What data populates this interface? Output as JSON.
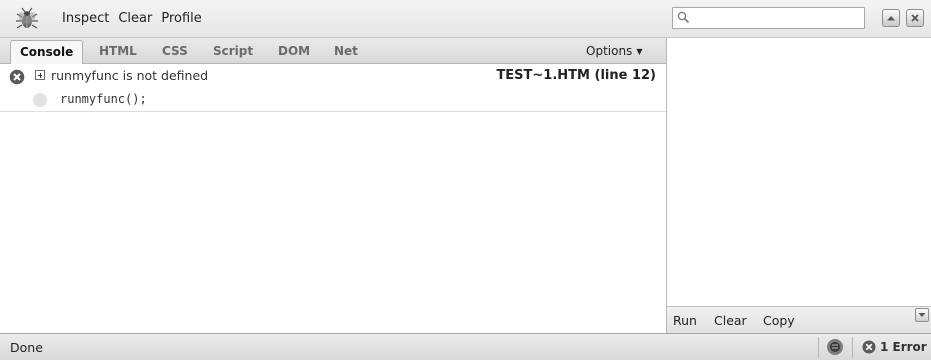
{
  "toolbar": {
    "menu": [
      "Inspect",
      "Clear",
      "Profile"
    ]
  },
  "search": {
    "value": "",
    "placeholder": ""
  },
  "tabs": [
    {
      "label": "Console",
      "active": true
    },
    {
      "label": "HTML",
      "active": false
    },
    {
      "label": "CSS",
      "active": false
    },
    {
      "label": "Script",
      "active": false
    },
    {
      "label": "DOM",
      "active": false
    },
    {
      "label": "Net",
      "active": false
    }
  ],
  "options_label": "Options",
  "console": {
    "error_message": "runmyfunc is not defined",
    "error_source": "TEST~1.HTM (line 12)",
    "source_line": "runmyfunc();"
  },
  "command_bar": {
    "run": "Run",
    "clear": "Clear",
    "copy": "Copy"
  },
  "status": {
    "text": "Done",
    "error_count": "1 Error"
  },
  "icons": {
    "app": "firebug-bug-icon",
    "error": "error-x-circle-icon",
    "status": "firebug-status-icon"
  }
}
